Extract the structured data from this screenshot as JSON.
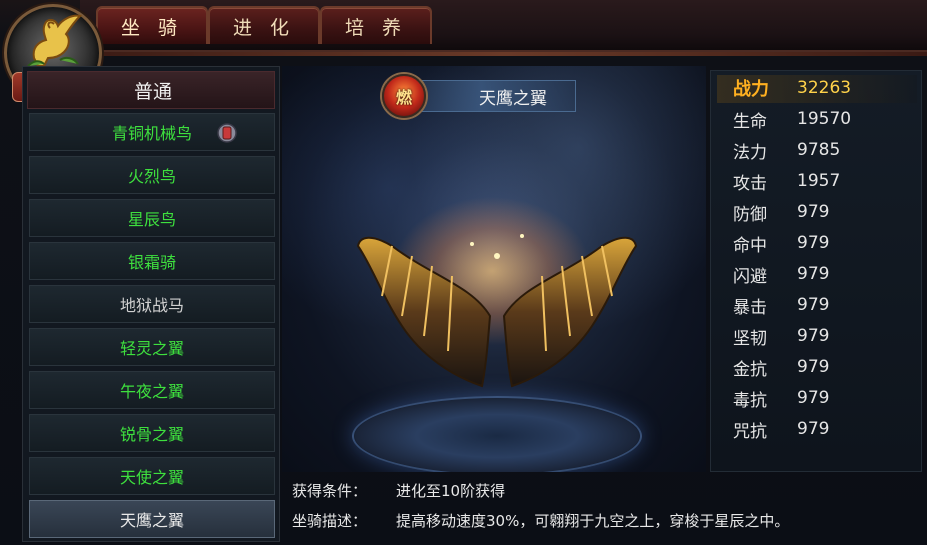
{
  "tabs": [
    {
      "label": "坐 骑"
    },
    {
      "label": "进 化"
    },
    {
      "label": "培 养"
    }
  ],
  "emblem": {
    "title": "坐骑"
  },
  "list": {
    "header": "普通",
    "items": [
      {
        "label": "青铜机械鸟",
        "color": "green"
      },
      {
        "label": "火烈鸟",
        "color": "green"
      },
      {
        "label": "星辰鸟",
        "color": "green"
      },
      {
        "label": "银霜骑",
        "color": "green"
      },
      {
        "label": "地狱战马",
        "color": "gray"
      },
      {
        "label": "轻灵之翼",
        "color": "green"
      },
      {
        "label": "午夜之翼",
        "color": "green"
      },
      {
        "label": "锐骨之翼",
        "color": "green"
      },
      {
        "label": "天使之翼",
        "color": "green"
      },
      {
        "label": "天鹰之翼",
        "color": "selected"
      }
    ]
  },
  "preview": {
    "burn_icon": "燃",
    "name": "天鹰之翼"
  },
  "info": {
    "condition_label": "获得条件：",
    "condition_value": "进化至10阶获得",
    "desc_label": "坐骑描述：",
    "desc_value": "提高移动速度30%，可翱翔于九空之上，穿梭于星辰之中。"
  },
  "stats": [
    {
      "k": "战力",
      "v": "32263"
    },
    {
      "k": "生命",
      "v": "19570"
    },
    {
      "k": "法力",
      "v": "9785"
    },
    {
      "k": "攻击",
      "v": "1957"
    },
    {
      "k": "防御",
      "v": "979"
    },
    {
      "k": "命中",
      "v": "979"
    },
    {
      "k": "闪避",
      "v": "979"
    },
    {
      "k": "暴击",
      "v": "979"
    },
    {
      "k": "坚韧",
      "v": "979"
    },
    {
      "k": "金抗",
      "v": "979"
    },
    {
      "k": "毒抗",
      "v": "979"
    },
    {
      "k": "咒抗",
      "v": "979"
    }
  ]
}
